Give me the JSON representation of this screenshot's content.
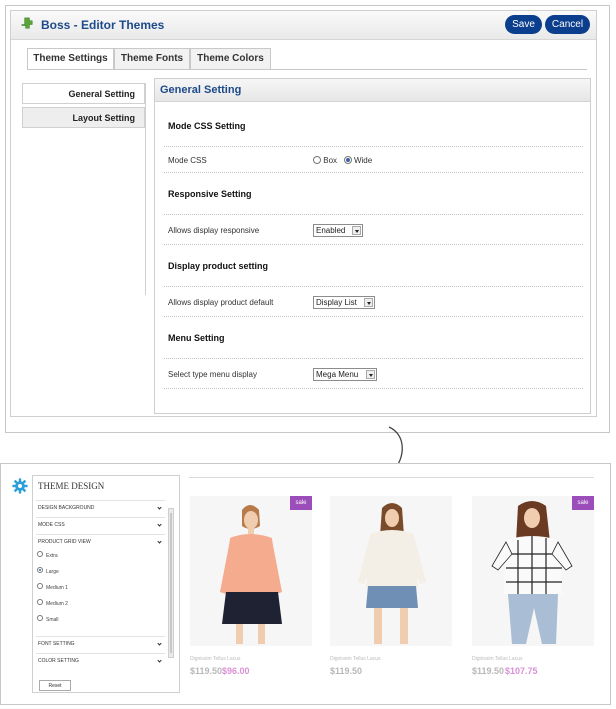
{
  "admin": {
    "title": "Boss - Editor Themes",
    "save_label": "Save",
    "cancel_label": "Cancel",
    "tabs": [
      "Theme Settings",
      "Theme Fonts",
      "Theme Colors"
    ],
    "side_nav": [
      "General Setting",
      "Layout Setting"
    ],
    "content_title": "General Setting",
    "sections": {
      "mode_css": "Mode CSS Setting",
      "responsive": "Responsive Setting",
      "display_product": "Display product setting",
      "menu": "Menu Setting"
    },
    "rows": {
      "mode_css_label": "Mode CSS",
      "mode_css_options": [
        "Box",
        "Wide"
      ],
      "mode_css_selected": "Wide",
      "responsive_label": "Allows display responsive",
      "responsive_value": "Enabled",
      "product_label": "Allows display product default",
      "product_value": "Display List",
      "menu_label": "Select type menu display",
      "menu_value": "Mega Menu"
    },
    "colors": {
      "brand": "#0b3e8d",
      "title": "#1d4a8a"
    }
  },
  "theme_design": {
    "title": "THEME DESIGN",
    "groups": [
      "DESIGN BACKGROUND",
      "MODE CSS",
      "PRODUCT GRID VIEW",
      "FONT SETTING",
      "COLOR SETTING"
    ],
    "grid_options": [
      "Extra",
      "Large",
      "Medium 1",
      "Medium 2",
      "Small"
    ],
    "grid_selected": "Large",
    "reset_label": "Reset"
  },
  "products": [
    {
      "name": "Dignissim Tellus Lacus",
      "old_price": "$119.50",
      "new_price": "$96.00",
      "sale": "sale"
    },
    {
      "name": "Dignissim Tellus Lacus",
      "old_price": "$119.50",
      "new_price": "",
      "sale": ""
    },
    {
      "name": "Dignissim Tellus Lacus",
      "old_price": "$119.50",
      "new_price": "$107.75",
      "sale": "sale"
    }
  ]
}
